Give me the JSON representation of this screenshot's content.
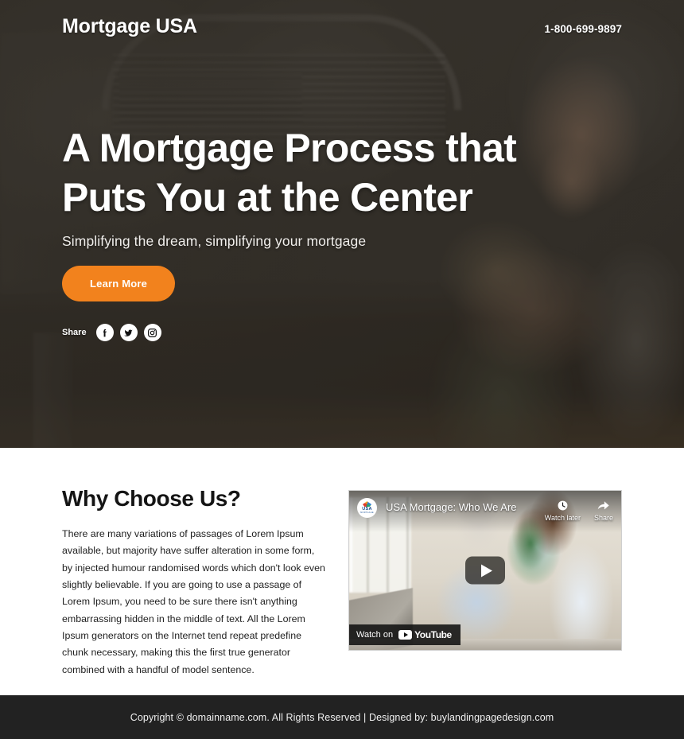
{
  "header": {
    "logo": "Mortgage USA",
    "phone": "1-800-699-9897"
  },
  "hero": {
    "title_line1": "A Mortgage Process that",
    "title_line2": "Puts You at the Center",
    "subtitle": "Simplifying the dream, simplifying your mortgage",
    "cta_label": "Learn More",
    "share_label": "Share",
    "social": [
      {
        "name": "facebook",
        "icon": "facebook-icon"
      },
      {
        "name": "twitter",
        "icon": "twitter-icon"
      },
      {
        "name": "instagram",
        "icon": "instagram-icon"
      }
    ],
    "accent_color": "#f2821d",
    "overlay_color": "#2e2a24"
  },
  "why": {
    "title": "Why Choose Us?",
    "body": "There are many variations of passages of Lorem Ipsum available, but majority have suffer alteration in some form, by injected humour randomised words which don't look even slightly believable. If you are going to use a passage of Lorem Ipsum, you need to be sure there isn't anything embarrassing hidden in the middle of text. All the Lorem Ipsum generators on the Internet tend repeat predefine chunk necessary, making this the first true generator combined with a handful of model sentence."
  },
  "video": {
    "title": "USA Mortgage: Who We Are",
    "channel_avatar_text": "USA",
    "channel_avatar_subtext": "MORTGAGE",
    "watch_later_label": "Watch later",
    "share_label": "Share",
    "watch_on_label": "Watch on",
    "platform_label": "YouTube"
  },
  "footer": {
    "text": "Copyright © domainname.com. All Rights Reserved | Designed by: buylandingpagedesign.com",
    "background_color": "#222222"
  }
}
